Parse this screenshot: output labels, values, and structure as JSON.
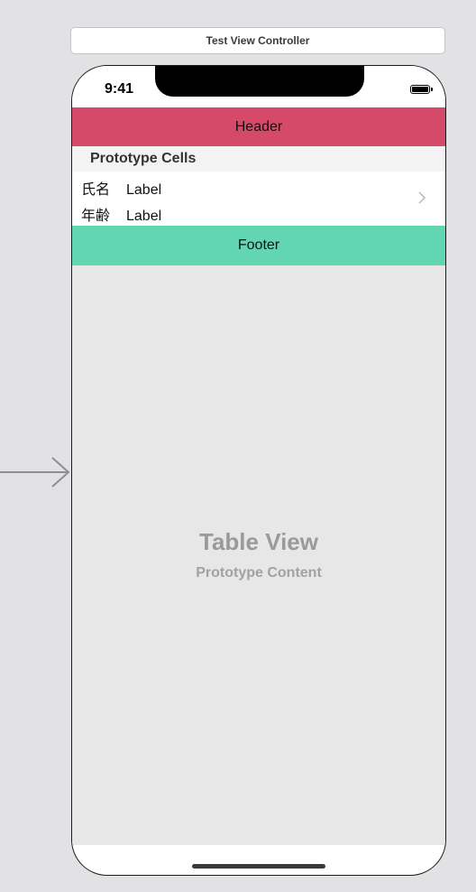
{
  "scene": {
    "title": "Test View Controller"
  },
  "status_bar": {
    "time": "9:41",
    "battery_icon": "battery-icon"
  },
  "table": {
    "header_label": "Header",
    "section_header": "Prototype Cells",
    "cell": {
      "rows": [
        {
          "title": "氏名",
          "value": "Label"
        },
        {
          "title": "年齢",
          "value": "Label"
        }
      ],
      "accessory_icon": "chevron-right-icon"
    },
    "footer_label": "Footer",
    "placeholder_title": "Table View",
    "placeholder_subtitle": "Prototype Content"
  },
  "colors": {
    "header_bg": "#d54a69",
    "footer_bg": "#62d6b0",
    "canvas_bg": "#e2e2e5",
    "table_bg": "#e7e7e7"
  }
}
